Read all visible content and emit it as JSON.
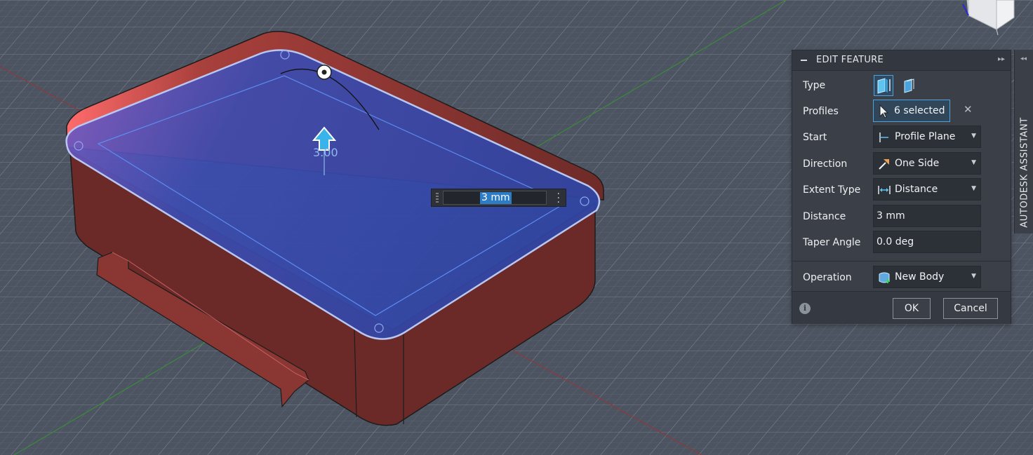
{
  "panel": {
    "title": "EDIT FEATURE",
    "rows": {
      "type": {
        "label": "Type"
      },
      "profiles": {
        "label": "Profiles",
        "value": "6 selected"
      },
      "start": {
        "label": "Start",
        "value": "Profile Plane"
      },
      "direction": {
        "label": "Direction",
        "value": "One Side"
      },
      "extent_type": {
        "label": "Extent Type",
        "value": "Distance"
      },
      "distance": {
        "label": "Distance",
        "value": "3 mm"
      },
      "taper_angle": {
        "label": "Taper Angle",
        "value": "0.0 deg"
      },
      "operation": {
        "label": "Operation",
        "value": "New Body"
      }
    },
    "ok_label": "OK",
    "cancel_label": "Cancel",
    "info_icon": "i"
  },
  "side_panel": {
    "label": "AUTODESK ASSISTANT"
  },
  "viewport": {
    "distance_input_value": "3 mm",
    "dimension_label": "3.00"
  },
  "colors": {
    "panel_bg": "#3b4048",
    "accent": "#4aa3dd",
    "body_red": "#6b2a28",
    "selection_blue": "#2f4aa6",
    "grid_bg": "#4d5461"
  }
}
